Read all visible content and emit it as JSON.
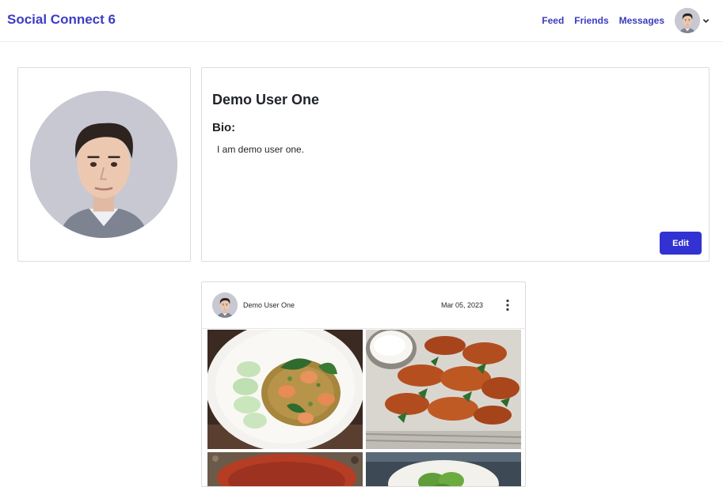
{
  "navbar": {
    "brand": "Social Connect 6",
    "links": [
      "Feed",
      "Friends",
      "Messages"
    ],
    "account_icon": "chevron-down-icon"
  },
  "profile": {
    "name": "Demo User One",
    "bio_heading": "Bio:",
    "bio_text": "I am demo user one.",
    "edit_label": "Edit"
  },
  "post": {
    "author": "Demo User One",
    "date": "Mar 05, 2023",
    "menu_icon": "more-vertical-icon",
    "photos": [
      "shrimp-rice-plate-photo",
      "chicken-wings-photo",
      "red-bowl-photo",
      "salad-plate-photo"
    ]
  },
  "colors": {
    "brand": "#3d3dc4",
    "nav_link": "#3b3bbd",
    "primary_button": "#3232d2"
  }
}
